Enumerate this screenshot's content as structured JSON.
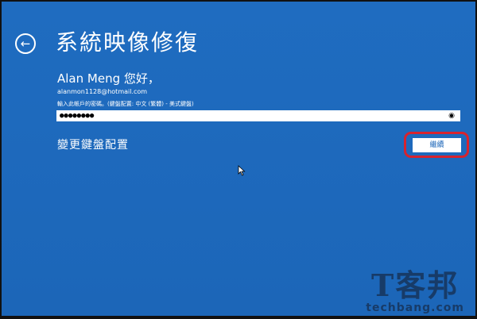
{
  "header": {
    "back_icon": "back-arrow-icon",
    "title": "系統映像修復"
  },
  "account": {
    "greeting": "Alan Meng 您好，",
    "email": "alanmon1128@hotmail.com"
  },
  "password": {
    "label": "輸入此帳戶的密碼。(鍵盤配置: 中文 (繁體) - 美式鍵盤)",
    "value": "●●●●●●●●",
    "reveal_icon": "eye-icon"
  },
  "links": {
    "change_keyboard": "變更鍵盤配置"
  },
  "actions": {
    "next_label": "繼續"
  },
  "watermark": {
    "main": "T客邦",
    "sub": "techbang.com"
  },
  "colors": {
    "background": "#1c66b8",
    "highlight": "#d7232e"
  }
}
